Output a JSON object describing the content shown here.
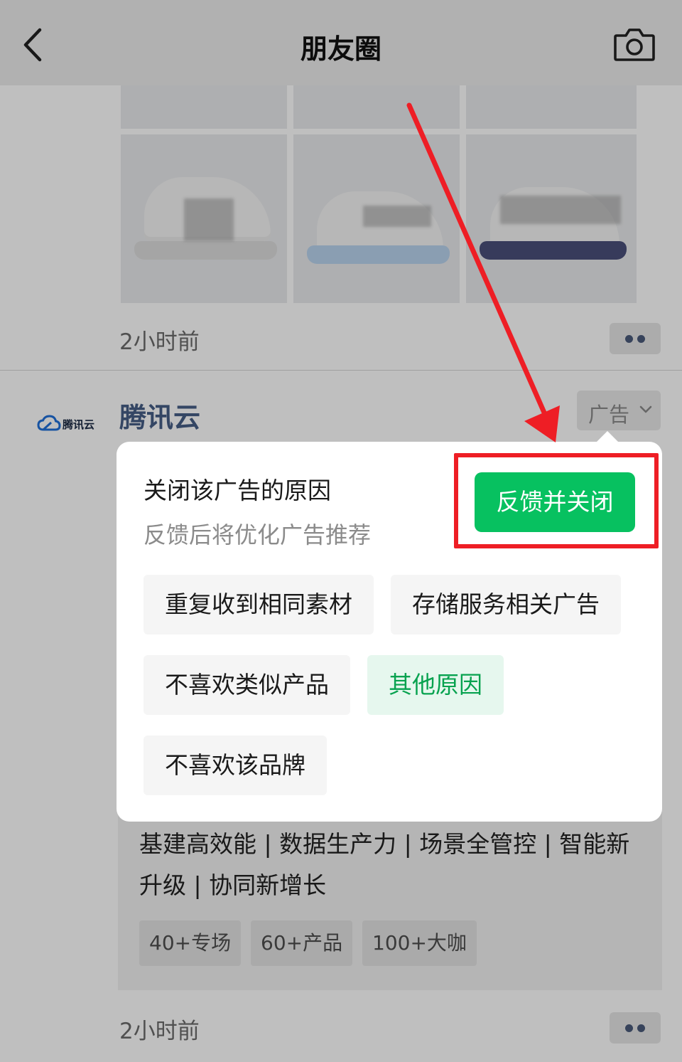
{
  "navbar": {
    "title": "朋友圈",
    "back_icon": "chevron-left-icon",
    "camera_icon": "camera-icon"
  },
  "post_1": {
    "time": "2小时前",
    "more_icon": "more-dots-icon"
  },
  "ad_post": {
    "avatar_text": "腾讯云",
    "avatar_icon": "cloud-logo-icon",
    "name": "腾讯云",
    "ad_tag": "广告",
    "description": "基建高效能 | 数据生产力 | 场景全管控 | 智能新升级 | 协同新增长",
    "chips": [
      "40+专场",
      "60+产品",
      "100+大咖"
    ],
    "time": "2小时前"
  },
  "popup": {
    "title": "关闭该广告的原因",
    "subtitle": "反馈后将优化广告推荐",
    "submit_label": "反馈并关闭",
    "reasons": [
      "重复收到相同素材",
      "存储服务相关广告",
      "不喜欢类似产品",
      "其他原因",
      "不喜欢该品牌"
    ],
    "selected_reason": "其他原因"
  },
  "colors": {
    "accent_green": "#07c160",
    "selected_text": "#07a24f",
    "selected_bg": "#e6f7ee",
    "annotation_red": "#ee1e25",
    "link_blue": "#465e86"
  }
}
